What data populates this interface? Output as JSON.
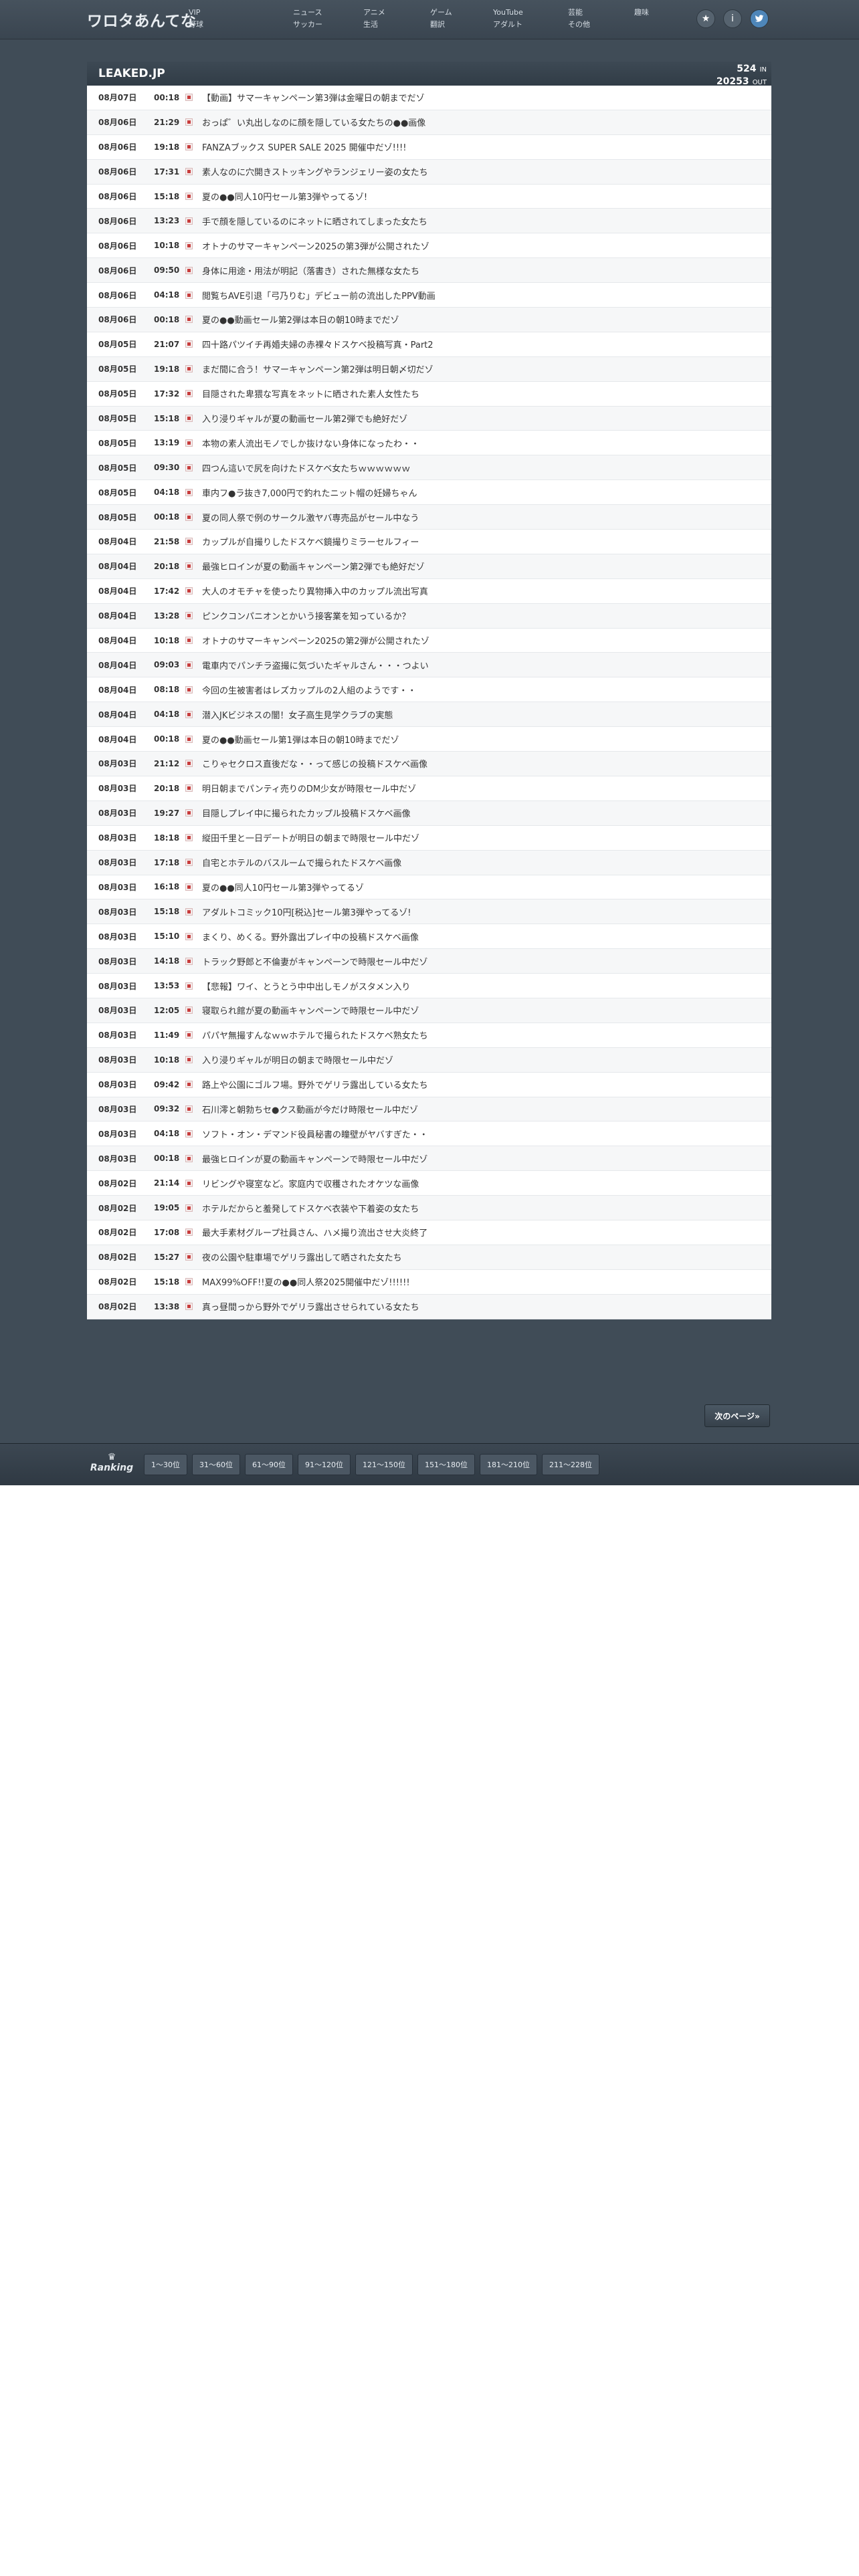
{
  "site": {
    "logo": "ワロタあんてな"
  },
  "nav": [
    [
      "VIP",
      "野球"
    ],
    [
      "ニュース",
      "サッカー"
    ],
    [
      "アニメ",
      "生活"
    ],
    [
      "ゲーム",
      "翻訳"
    ],
    [
      "YouTube",
      "アダルト"
    ],
    [
      "芸能",
      "その他"
    ],
    [
      "趣味"
    ]
  ],
  "icons": {
    "favorite": "star-icon",
    "info": "info-icon",
    "twitter": "twitter-bird-icon"
  },
  "panel": {
    "title": "LEAKED.JP",
    "in_count": "524",
    "in_label": "IN",
    "out_count": "20253",
    "out_label": "OUT"
  },
  "entries": [
    {
      "date": "08月07日",
      "time": "00:18",
      "title": "【動画】サマーキャンペーン第3弾は金曜日の朝までだゾ"
    },
    {
      "date": "08月06日",
      "time": "21:29",
      "title": "おっぱ゛い丸出しなのに顔を隠している女たちの●●画像"
    },
    {
      "date": "08月06日",
      "time": "19:18",
      "title": "FANZAブックス SUPER SALE 2025 開催中だゾ!!!!"
    },
    {
      "date": "08月06日",
      "time": "17:31",
      "title": "素人なのに穴開きストッキングやランジェリー姿の女たち"
    },
    {
      "date": "08月06日",
      "time": "15:18",
      "title": "夏の●●同人10円セール第3弾やってるゾ!"
    },
    {
      "date": "08月06日",
      "time": "13:23",
      "title": "手で顔を隠しているのにネットに晒されてしまった女たち"
    },
    {
      "date": "08月06日",
      "time": "10:18",
      "title": "オトナのサマーキャンペーン2025の第3弾が公開されたゾ"
    },
    {
      "date": "08月06日",
      "time": "09:50",
      "title": "身体に用途・用法が明記（落書き）された無様な女たち"
    },
    {
      "date": "08月06日",
      "time": "04:18",
      "title": "閲覧ちAVE引退「弓乃りむ」デビュー前の流出したPPV動画"
    },
    {
      "date": "08月06日",
      "time": "00:18",
      "title": "夏の●●動画セール第2弾は本日の朝10時までだゾ"
    },
    {
      "date": "08月05日",
      "time": "21:07",
      "title": "四十路パツイチ再婚夫婦の赤裸々ドスケベ投稿写真・Part2"
    },
    {
      "date": "08月05日",
      "time": "19:18",
      "title": "まだ間に合う！サマーキャンペーン第2弾は明日朝〆切だゾ"
    },
    {
      "date": "08月05日",
      "time": "17:32",
      "title": "目隠された卑猥な写真をネットに晒された素人女性たち"
    },
    {
      "date": "08月05日",
      "time": "15:18",
      "title": "入り浸りギャルが夏の動画セール第2弾でも絶好だゾ"
    },
    {
      "date": "08月05日",
      "time": "13:19",
      "title": "本物の素人流出モノでしか抜けない身体になったわ・・"
    },
    {
      "date": "08月05日",
      "time": "09:30",
      "title": "四つん這いで尻を向けたドスケベ女たちｗｗｗｗｗｗ"
    },
    {
      "date": "08月05日",
      "time": "04:18",
      "title": "車内フ●ラ抜き7,000円で釣れたニット帽の妊婦ちゃん"
    },
    {
      "date": "08月05日",
      "time": "00:18",
      "title": "夏の同人祭で例のサークル激ヤバ専売品がセール中なう"
    },
    {
      "date": "08月04日",
      "time": "21:58",
      "title": "カップルが自撮りしたドスケベ鏡撮りミラーセルフィー"
    },
    {
      "date": "08月04日",
      "time": "20:18",
      "title": "最強ヒロインが夏の動画キャンペーン第2弾でも絶好だゾ"
    },
    {
      "date": "08月04日",
      "time": "17:42",
      "title": "大人のオモチャを使ったり異物挿入中のカップル流出写真"
    },
    {
      "date": "08月04日",
      "time": "13:28",
      "title": "ピンクコンパニオンとかいう接客業を知っているか？"
    },
    {
      "date": "08月04日",
      "time": "10:18",
      "title": "オトナのサマーキャンペーン2025の第2弾が公開されたゾ"
    },
    {
      "date": "08月04日",
      "time": "09:03",
      "title": "電車内でパンチラ盗撮に気づいたギャルさん・・・つよい"
    },
    {
      "date": "08月04日",
      "time": "08:18",
      "title": "今回の生被害者はレズカップルの2人組のようです・・"
    },
    {
      "date": "08月04日",
      "time": "04:18",
      "title": "潜入JKビジネスの闇！女子高生見学クラブの実態"
    },
    {
      "date": "08月04日",
      "time": "00:18",
      "title": "夏の●●動画セール第1弾は本日の朝10時までだゾ"
    },
    {
      "date": "08月03日",
      "time": "21:12",
      "title": "こりゃセクロス直後だな・・って感じの投稿ドスケベ画像"
    },
    {
      "date": "08月03日",
      "time": "20:18",
      "title": "明日朝までパンティ売りのDM少女が時限セール中だゾ"
    },
    {
      "date": "08月03日",
      "time": "19:27",
      "title": "目隠しプレイ中に撮られたカップル投稿ドスケベ画像"
    },
    {
      "date": "08月03日",
      "time": "18:18",
      "title": "縦田千里と一日デートが明日の朝まで時限セール中だゾ"
    },
    {
      "date": "08月03日",
      "time": "17:18",
      "title": "自宅とホテルのバスルームで撮られたドスケベ画像"
    },
    {
      "date": "08月03日",
      "time": "16:18",
      "title": "夏の●●同人10円セール第3弾やってるゾ"
    },
    {
      "date": "08月03日",
      "time": "15:18",
      "title": "アダルトコミック10円[税込]セール第3弾やってるゾ!"
    },
    {
      "date": "08月03日",
      "time": "15:10",
      "title": "まくり、めくる。野外露出プレイ中の投稿ドスケベ画像"
    },
    {
      "date": "08月03日",
      "time": "14:18",
      "title": "トラック野郎と不倫妻がキャンペーンで時限セール中だゾ"
    },
    {
      "date": "08月03日",
      "time": "13:53",
      "title": "【悲報】ワイ、とうとう中中出しモノがスタメン入り"
    },
    {
      "date": "08月03日",
      "time": "12:05",
      "title": "寝取られ館が夏の動画キャンペーンで時限セール中だゾ"
    },
    {
      "date": "08月03日",
      "time": "11:49",
      "title": "パパヤ無撮すんなｗｗホテルで撮られたドスケベ熟女たち"
    },
    {
      "date": "08月03日",
      "time": "10:18",
      "title": "入り浸りギャルが明日の朝まで時限セール中だゾ"
    },
    {
      "date": "08月03日",
      "time": "09:42",
      "title": "路上や公園にゴルフ場。野外でゲリラ露出している女たち"
    },
    {
      "date": "08月03日",
      "time": "09:32",
      "title": "石川澪と朝勃ちセ●クス動画が今だけ時限セール中だゾ"
    },
    {
      "date": "08月03日",
      "time": "04:18",
      "title": "ソフト・オン・デマンド役員秘書の瞳壁がヤバすぎた・・"
    },
    {
      "date": "08月03日",
      "time": "00:18",
      "title": "最強ヒロインが夏の動画キャンペーンで時限セール中だゾ"
    },
    {
      "date": "08月02日",
      "time": "21:14",
      "title": "リビングや寝室など。家庭内で収穫されたオケツな画像"
    },
    {
      "date": "08月02日",
      "time": "19:05",
      "title": "ホテルだからと羞発してドスケベ衣装や下着姿の女たち"
    },
    {
      "date": "08月02日",
      "time": "17:08",
      "title": "最大手素材グループ社員さん、ハメ撮り流出させ大炎終了"
    },
    {
      "date": "08月02日",
      "time": "15:27",
      "title": "夜の公園や駐車場でゲリラ露出して晒された女たち"
    },
    {
      "date": "08月02日",
      "time": "15:18",
      "title": "MAX99%OFF!!夏の●●同人祭2025開催中だゾ!!!!!!"
    },
    {
      "date": "08月02日",
      "time": "13:38",
      "title": "真っ昼間っから野外でゲリラ露出させられている女たち"
    }
  ],
  "pager": {
    "next_label": "次のページ»"
  },
  "ranking": {
    "label": "Ranking",
    "ranges": [
      "1〜30位",
      "31〜60位",
      "61〜90位",
      "91〜120位",
      "121〜150位",
      "151〜180位",
      "181〜210位",
      "211〜228位"
    ]
  }
}
